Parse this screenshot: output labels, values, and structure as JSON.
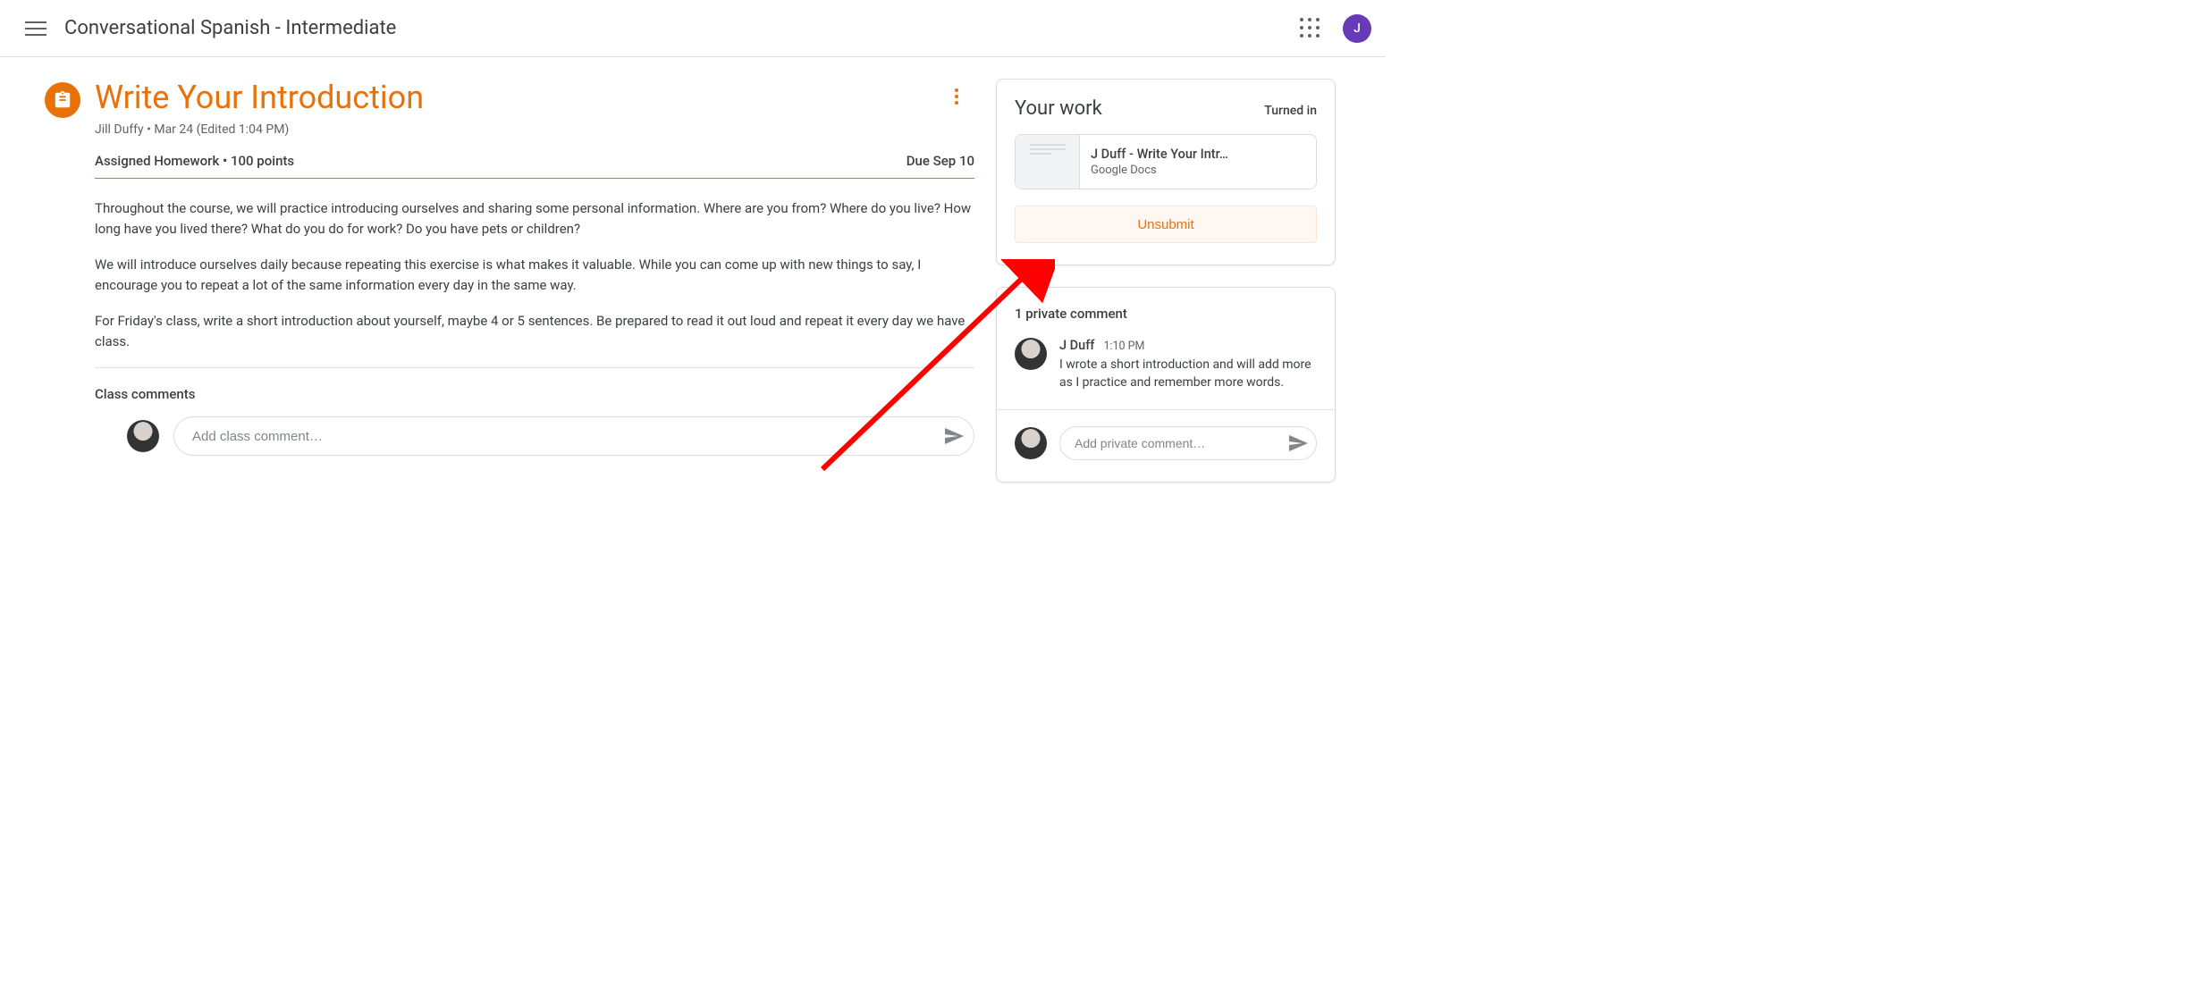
{
  "header": {
    "class_title": "Conversational Spanish - Intermediate",
    "avatar_initial": "J"
  },
  "assignment": {
    "title": "Write Your Introduction",
    "byline": "Jill Duffy • Mar 24 (Edited 1:04 PM)",
    "meta_left": "Assigned Homework • 100 points",
    "due": "Due Sep 10",
    "paragraphs": [
      "Throughout the course, we will practice introducing ourselves and sharing some personal information. Where are you from? Where do you live? How long have you lived there? What do you do for work? Do you have pets or children?",
      "We will introduce ourselves daily because repeating this exercise is what makes it valuable. While you can come up with new things to say, I encourage you to repeat a lot of the same information every day in the same way.",
      "For Friday's class, write a short introduction about yourself, maybe 4 or 5 sentences. Be prepared to read it out loud and repeat it every day we have class."
    ],
    "class_comments_heading": "Class comments",
    "class_comment_placeholder": "Add class comment…"
  },
  "your_work": {
    "heading": "Your work",
    "status": "Turned in",
    "attachment": {
      "title": "J Duff - Write Your Intr…",
      "type": "Google Docs"
    },
    "unsubmit_label": "Unsubmit"
  },
  "private_comments": {
    "heading": "1 private comment",
    "comment": {
      "author": "J Duff",
      "time": "1:10 PM",
      "text": "I wrote a short introduction and will add more as I practice and remember more words."
    },
    "placeholder": "Add private comment…"
  }
}
